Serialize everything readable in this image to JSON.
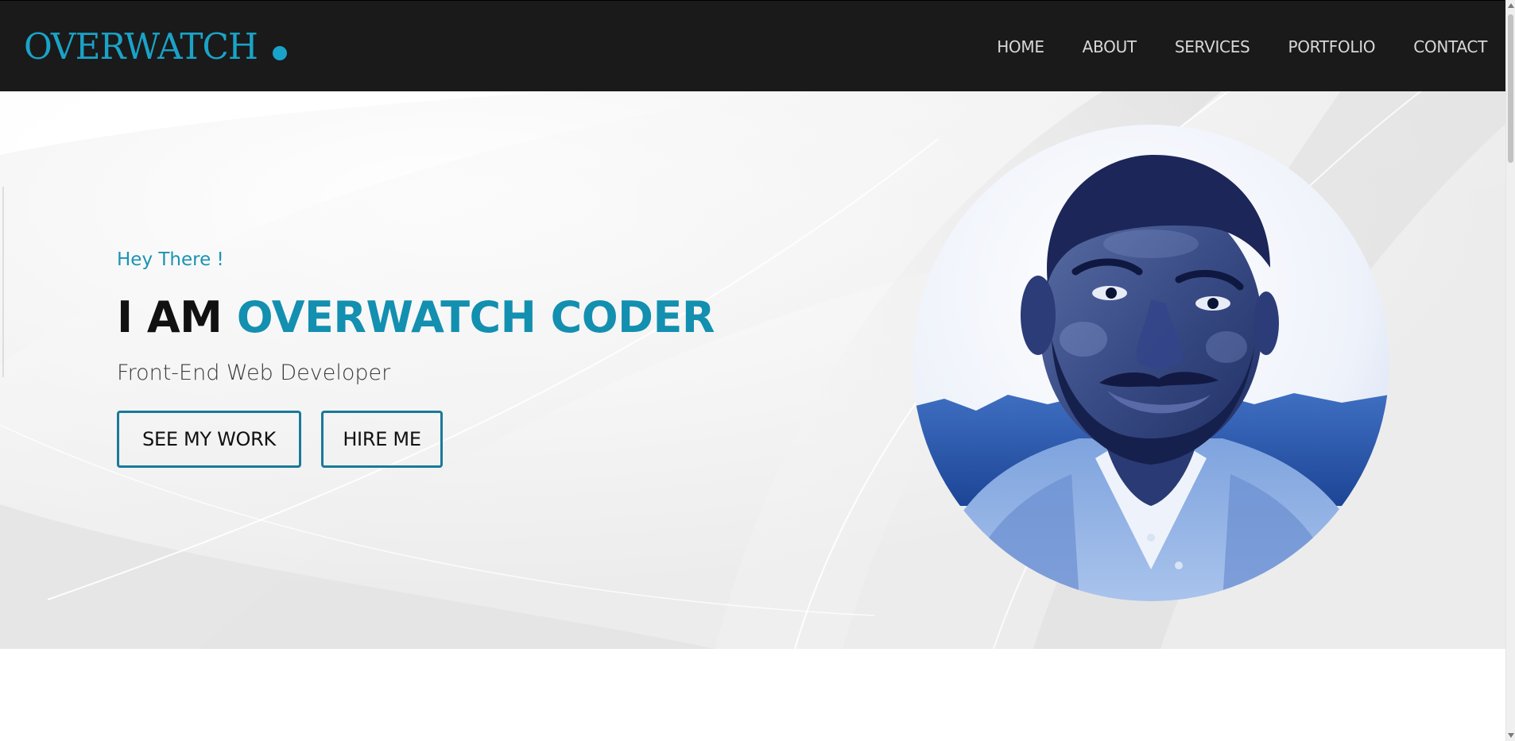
{
  "nav": {
    "logo_text": "OVERWATCH",
    "links": [
      "HOME",
      "ABOUT",
      "SERVICES",
      "PORTFOLIO",
      "CONTACT"
    ]
  },
  "hero": {
    "greeting": "Hey There !",
    "headline_prefix": "I AM",
    "headline_name": "OVERWATCH CODER",
    "subtitle": "Front-End Web Developer",
    "buttons": {
      "work": "SEE MY WORK",
      "hire": "HIRE ME"
    },
    "portrait_alt": "Stylized portrait of the developer"
  },
  "colors": {
    "accent": "#138fb0",
    "logo": "#1aa3c8",
    "navbar_bg": "#1a1a1a",
    "button_border": "#197a99",
    "portrait_tint": "#2a5aa8"
  },
  "icons": {
    "logo_dot": "dot-icon",
    "scroll_up": "scroll-up-arrow-icon",
    "scroll_down": "scroll-down-arrow-icon"
  }
}
